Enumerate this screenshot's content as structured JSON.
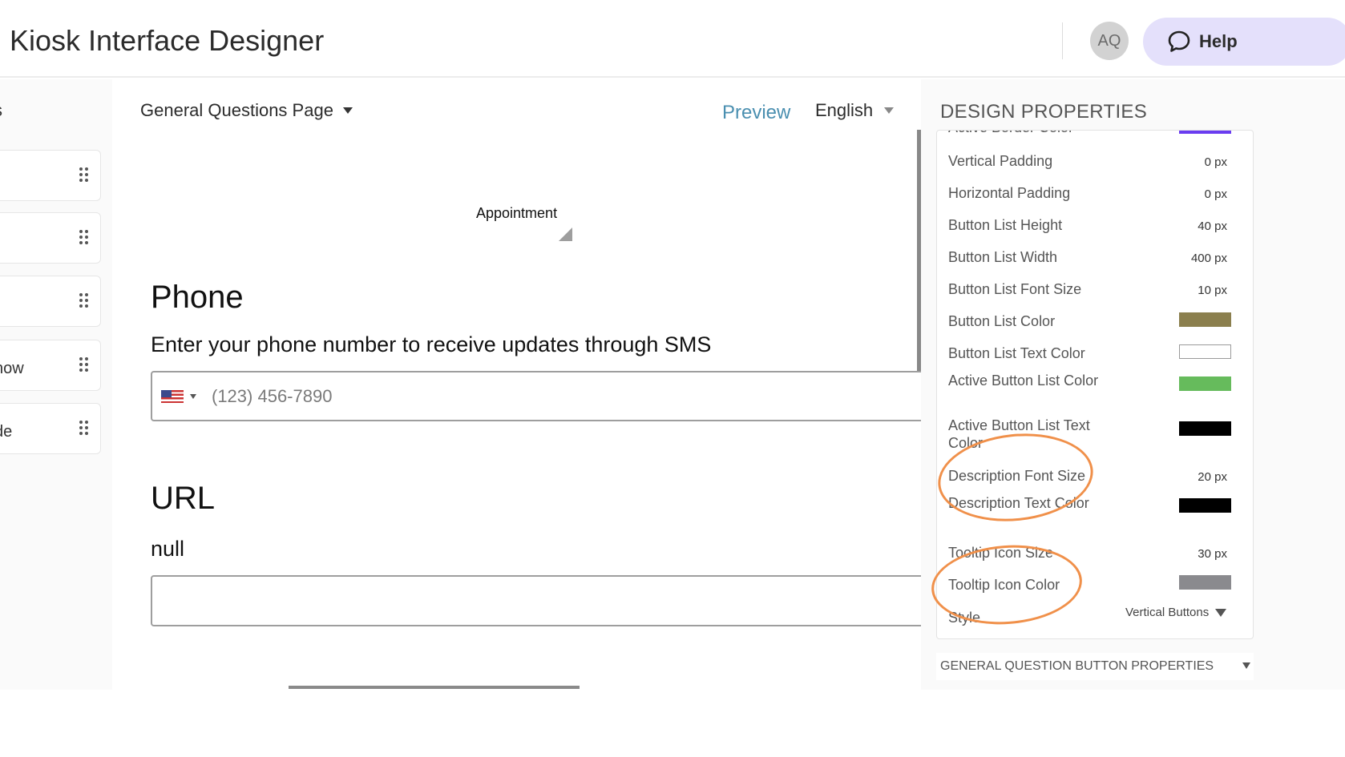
{
  "header": {
    "title": "Kiosk Interface Designer",
    "avatar_initials": "AQ",
    "help_label": "Help"
  },
  "left_rail": {
    "heading_fragment": "s",
    "items": [
      {
        "label": ""
      },
      {
        "label": ""
      },
      {
        "label": ""
      },
      {
        "label": "now"
      },
      {
        "label": "de"
      }
    ]
  },
  "toolbar": {
    "page_select": "General Questions Page",
    "preview": "Preview",
    "language": "English"
  },
  "canvas": {
    "appointment_label": "Appointment",
    "phone": {
      "title": "Phone",
      "description": "Enter your phone number to receive updates through SMS",
      "placeholder": "(123) 456-7890"
    },
    "url": {
      "title": "URL",
      "description": "null",
      "value": ""
    }
  },
  "design_properties": {
    "heading": "DESIGN PROPERTIES",
    "partial_label": "Active Border Color",
    "partial_color": "#6a3cf0",
    "rows": {
      "vertical_padding": {
        "label": "Vertical Padding",
        "value": "0 px"
      },
      "horizontal_padding": {
        "label": "Horizontal Padding",
        "value": "0 px"
      },
      "button_list_height": {
        "label": "Button List Height",
        "value": "40 px"
      },
      "button_list_width": {
        "label": "Button List Width",
        "value": "400 px"
      },
      "button_list_font_size": {
        "label": "Button List Font Size",
        "value": "10 px"
      },
      "button_list_color": {
        "label": "Button List Color",
        "color": "#8b7f4e"
      },
      "button_list_text_color": {
        "label": "Button List Text Color",
        "color": "#ffffff"
      },
      "active_button_list_color": {
        "label": "Active Button List Color",
        "color": "#66bb5c"
      },
      "active_button_list_text_color": {
        "label": "Active Button List Text Color",
        "color": "#000000"
      },
      "description_font_size": {
        "label": "Description Font Size",
        "value": "20 px"
      },
      "description_text_color": {
        "label": "Description Text Color",
        "color": "#000000"
      },
      "tooltip_icon_size": {
        "label": "Tooltip Icon Size",
        "value": "30 px"
      },
      "tooltip_icon_color": {
        "label": "Tooltip Icon Color",
        "color": "#8a8a8e"
      },
      "style": {
        "label": "Style",
        "value": "Vertical Buttons"
      }
    }
  },
  "bottom_section": {
    "label": "GENERAL QUESTION BUTTON PROPERTIES"
  },
  "colors": {
    "accent_preview": "#4a8fb0",
    "help_bg": "#e4e0fb",
    "highlight": "#f0904a"
  }
}
